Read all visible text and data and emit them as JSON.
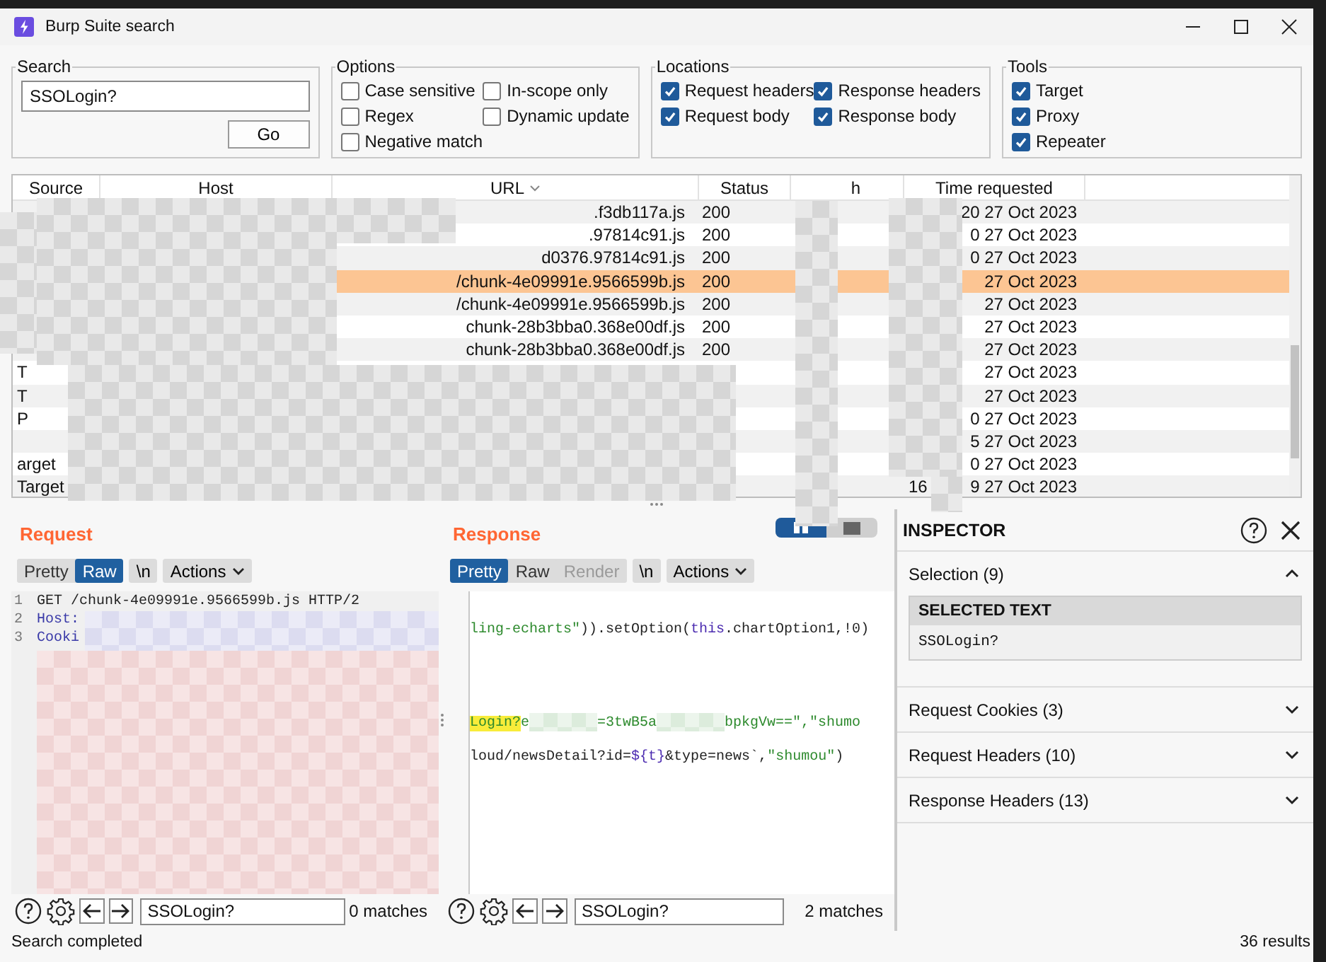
{
  "window": {
    "title": "Burp Suite search"
  },
  "search": {
    "label": "Search",
    "value": "SSOLogin?",
    "button": "Go"
  },
  "options": {
    "label": "Options",
    "items": [
      {
        "label": "Case sensitive",
        "checked": false
      },
      {
        "label": "In-scope only",
        "checked": false
      },
      {
        "label": "Regex",
        "checked": false
      },
      {
        "label": "Dynamic update",
        "checked": false
      },
      {
        "label": "Negative match",
        "checked": false
      }
    ]
  },
  "locations": {
    "label": "Locations",
    "items": [
      {
        "label": "Request headers",
        "checked": true
      },
      {
        "label": "Response headers",
        "checked": true
      },
      {
        "label": "Request body",
        "checked": true
      },
      {
        "label": "Response body",
        "checked": true
      }
    ]
  },
  "tools": {
    "label": "Tools",
    "items": [
      {
        "label": "Target",
        "checked": true
      },
      {
        "label": "Proxy",
        "checked": true
      },
      {
        "label": "Repeater",
        "checked": true
      }
    ]
  },
  "table": {
    "columns": [
      {
        "label": "Source",
        "sorted": false
      },
      {
        "label": "Host",
        "sorted": false
      },
      {
        "label": "URL",
        "sorted": true
      },
      {
        "label": "Status",
        "sorted": false
      },
      {
        "label": "h",
        "sorted": false
      },
      {
        "label": "Time requested",
        "sorted": false
      }
    ],
    "rows": [
      {
        "url": ".f3db117a.js",
        "status": "200",
        "time": "20 27 Oct 2023",
        "selected": false
      },
      {
        "url": ".97814c91.js",
        "status": "200",
        "time": "0 27 Oct 2023",
        "selected": false
      },
      {
        "url": "d0376.97814c91.js",
        "status": "200",
        "time": "0 27 Oct 2023",
        "selected": false
      },
      {
        "url": "/chunk-4e09991e.9566599b.js",
        "status": "200",
        "time": "27 Oct 2023",
        "selected": true
      },
      {
        "url": "/chunk-4e09991e.9566599b.js",
        "status": "200",
        "time": "27 Oct 2023",
        "selected": false
      },
      {
        "url": "chunk-28b3bba0.368e00df.js",
        "status": "200",
        "time": "27 Oct 2023",
        "selected": false
      },
      {
        "url": "chunk-28b3bba0.368e00df.js",
        "status": "200",
        "time": "27 Oct 2023",
        "selected": false
      },
      {
        "source": "T",
        "time": "27 Oct 2023",
        "selected": false
      },
      {
        "source": "T",
        "time": "27 Oct 2023",
        "selected": false
      },
      {
        "source": "P",
        "time": "0 27 Oct 2023",
        "selected": false
      },
      {
        "time": "5 27 Oct 2023",
        "selected": false
      },
      {
        "source": "arget",
        "time": "0 27 Oct 2023",
        "selected": false
      },
      {
        "source": "Target",
        "time_start": "16",
        "time": "9 27 Oct 2023",
        "selected": false
      }
    ]
  },
  "request": {
    "title": "Request",
    "view_tabs": [
      {
        "label": "Pretty",
        "selected": false,
        "disabled": false
      },
      {
        "label": "Raw",
        "selected": true,
        "disabled": false
      }
    ],
    "newline_button": "\\n",
    "actions_button": "Actions",
    "lines": [
      {
        "number": "1",
        "segments": [
          {
            "text": "GET /chunk-4e09991e.9566599b.js HTTP/2",
            "kind": "plain"
          }
        ]
      },
      {
        "number": "2",
        "segments": [
          {
            "text": "Host:",
            "kind": "header"
          }
        ]
      },
      {
        "number": "3",
        "segments": [
          {
            "text": "Cooki",
            "kind": "header"
          }
        ]
      }
    ],
    "find": {
      "value": "SSOLogin?",
      "matches": "0 matches"
    }
  },
  "response": {
    "title": "Response",
    "view_tabs": [
      {
        "label": "Pretty",
        "selected": true,
        "disabled": false
      },
      {
        "label": "Raw",
        "selected": false,
        "disabled": false
      },
      {
        "label": "Render",
        "selected": false,
        "disabled": true
      }
    ],
    "newline_button": "\\n",
    "actions_button": "Actions",
    "lines": [
      {
        "segments": [
          {
            "text": "ling-echarts\"",
            "kind": "string"
          },
          {
            "text": ")).setOption(",
            "kind": "plain"
          },
          {
            "text": "this",
            "kind": "keyword"
          },
          {
            "text": ".chartOption1,!0)",
            "kind": "plain"
          }
        ]
      },
      {
        "segments": [
          {
            "text": "Login?",
            "kind": "match"
          },
          {
            "text": "e",
            "kind": "string"
          },
          {
            "kind": "redacted"
          },
          {
            "text": "=3twB5a",
            "kind": "string"
          },
          {
            "kind": "redacted"
          },
          {
            "text": "bpkgVw==\",\"shumo",
            "kind": "string"
          }
        ]
      },
      {
        "segments": [
          {
            "text": "loud/newsDetail?id=",
            "kind": "plain"
          },
          {
            "text": "${t}",
            "kind": "keyword"
          },
          {
            "text": "&type=news`,",
            "kind": "plain"
          },
          {
            "text": "\"shumou\"",
            "kind": "string"
          },
          {
            "text": ")",
            "kind": "plain"
          }
        ]
      }
    ],
    "find": {
      "value": "SSOLogin?",
      "matches": "2 matches"
    }
  },
  "inspector": {
    "title": "INSPECTOR",
    "sections": [
      {
        "label": "Selection (9)",
        "expanded": true,
        "selected_text": {
          "heading": "SELECTED TEXT",
          "value": "SSOLogin?"
        }
      },
      {
        "label": "Request Cookies (3)",
        "expanded": false
      },
      {
        "label": "Request Headers (10)",
        "expanded": false
      },
      {
        "label": "Response Headers (13)",
        "expanded": false
      }
    ]
  },
  "status_bar": {
    "message": "Search completed",
    "results": "36 results"
  }
}
